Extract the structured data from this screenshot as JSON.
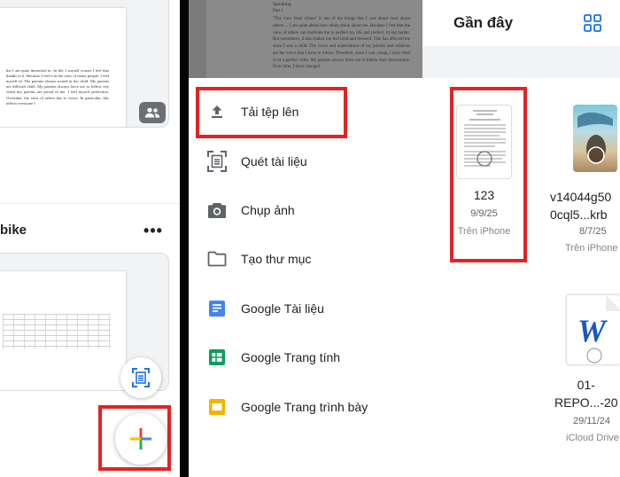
{
  "left_panel": {
    "doc_preview_text": "the I am quite interested in. In life. I myself ecause I feel that thanks to it. Because I feel it at the view of many people. I feel myself id. The parents always rooted in the child. My parents are difficult child. My parents always force me to follow ctly when my parents are proud of me. I feel myself perfection. Overtime, the view of others has er views. In particular, this affects everyone I",
    "file_title": "bike",
    "more_label": "•••",
    "colors": {
      "fab_plus_red": "#ea4335",
      "fab_plus_blue": "#4285f4",
      "fab_plus_green": "#34a853",
      "fab_plus_yellow": "#fbbc04",
      "highlight": "#e02424"
    }
  },
  "background_doc": {
    "heading": "Speaking",
    "subheading": "Part 1",
    "text": "\"The view from others\" is one of the things that I care about most about others ... I am quite about how others think about me. Because I feel that the view of others can motivate me to perfect my life and perfect, trying harder. But sometimes, it also makes me feel tired and stressed. This has affected me since I was a child. The views and expectations of my parents and relatives are the views that I have to follow. Therefore, since I was young, I have tried to be a perfect child. My parents always force me to follow their instructions. Over time, I have changed."
  },
  "recent": {
    "title": "Gần đây",
    "grid_icon": "grid-view-icon",
    "files": [
      {
        "name": "123",
        "date": "9/9/25",
        "location": "Trên iPhone",
        "type": "document-scan"
      },
      {
        "name": "v14044g50\n0cql5...krb",
        "date": "8/7/25",
        "location": "Trên iPhone",
        "type": "video"
      },
      {
        "name": "01-\nREPO...-20",
        "date": "29/11/24",
        "location": "iCloud Drive",
        "type": "word"
      }
    ]
  },
  "menu": {
    "items": [
      {
        "label": "Tải tệp lên",
        "icon": "upload-icon"
      },
      {
        "label": "Quét tài liệu",
        "icon": "scan-document-icon"
      },
      {
        "label": "Chụp ảnh",
        "icon": "camera-icon"
      },
      {
        "label": "Tạo thư mục",
        "icon": "folder-icon"
      },
      {
        "label": "Google Tài liệu",
        "icon": "google-docs-icon",
        "color": "#4285f4"
      },
      {
        "label": "Google Trang tính",
        "icon": "google-sheets-icon",
        "color": "#0f9d58"
      },
      {
        "label": "Google Trang trình bày",
        "icon": "google-slides-icon",
        "color": "#f4b400"
      }
    ]
  },
  "colors": {
    "primary_blue": "#1a73e8",
    "icon_gray": "#5f6368",
    "word_blue": "#185abd",
    "highlight_red": "#e02424"
  }
}
